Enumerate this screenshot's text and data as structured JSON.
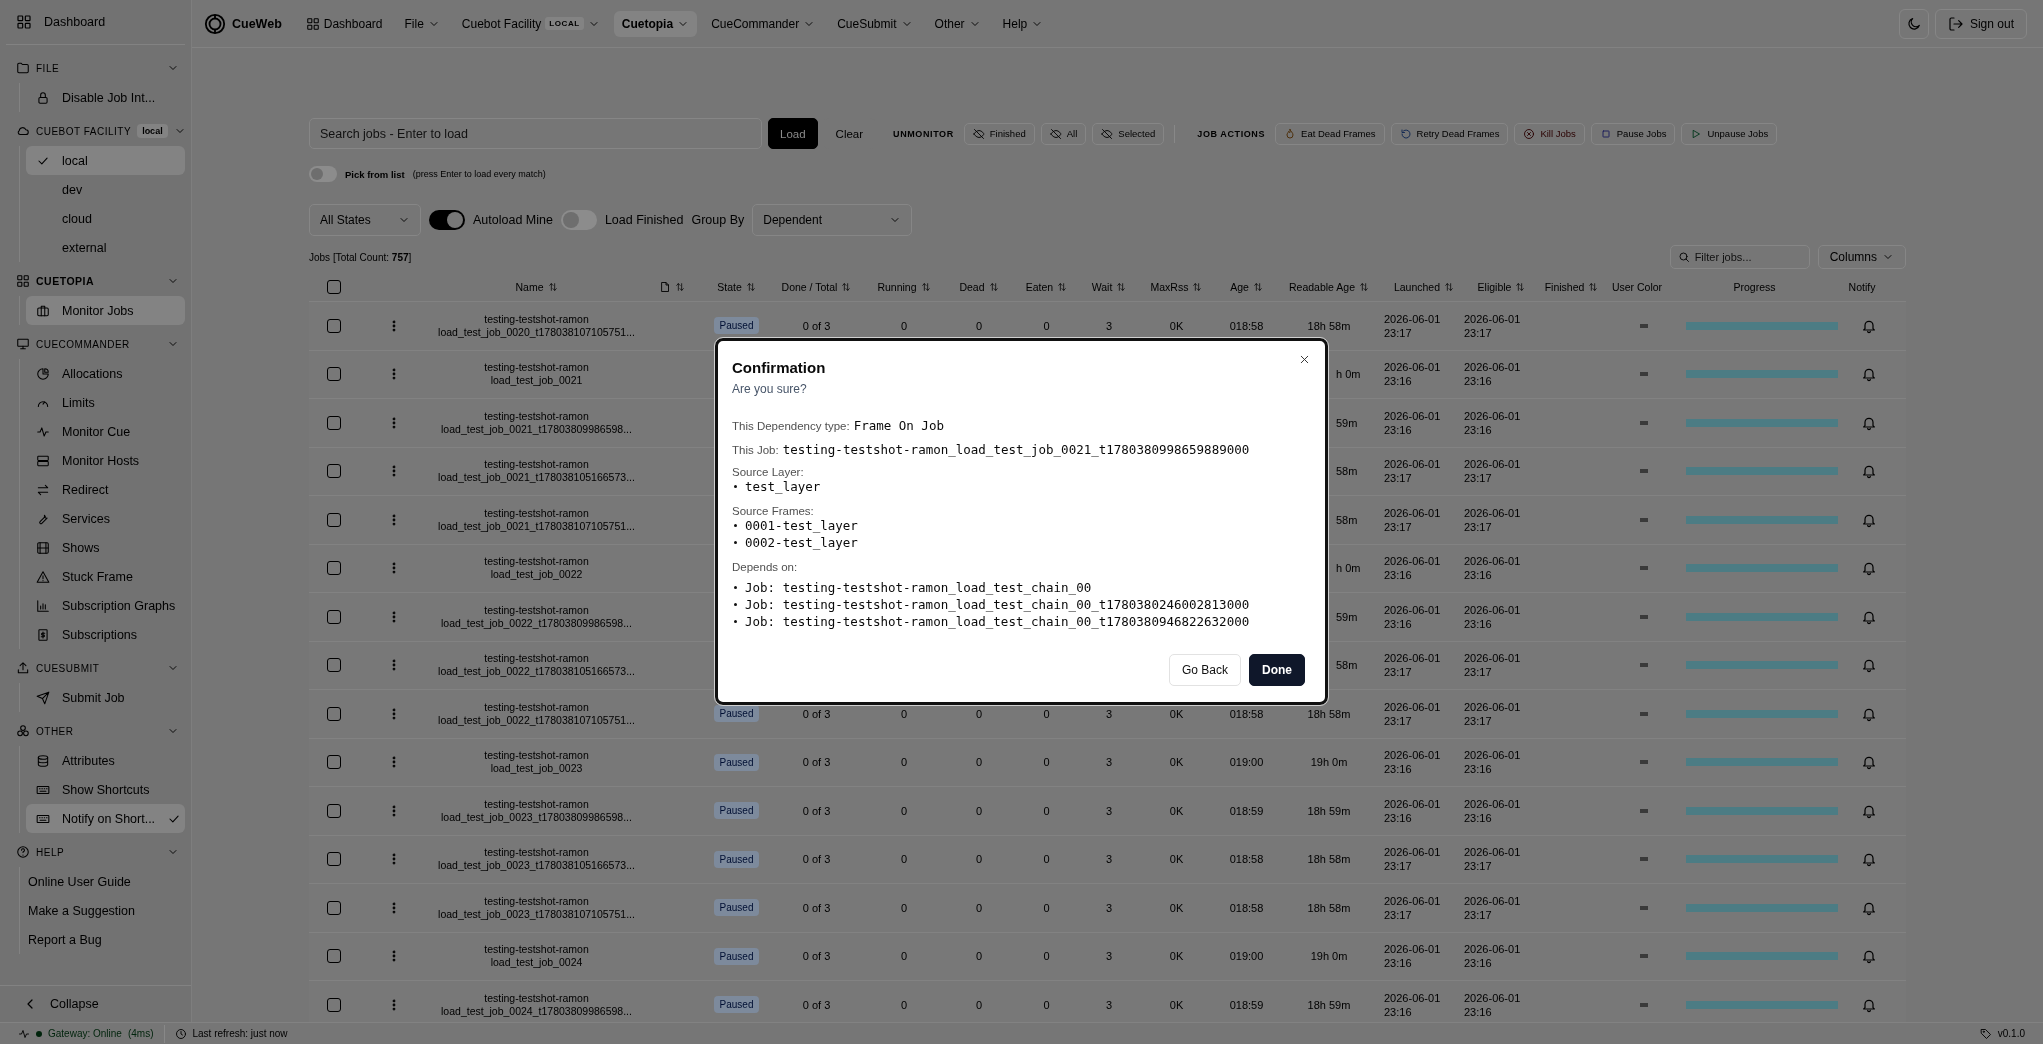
{
  "sidebar": {
    "dashboard": "Dashboard",
    "sections": [
      {
        "title": "FILE",
        "kind": "menu",
        "active": false,
        "items": [
          {
            "label": "Disable Job Int...",
            "selected": false
          }
        ]
      },
      {
        "title": "CUEBOT FACILITY",
        "badge": "local",
        "kind": "radio",
        "active": false,
        "items": [
          {
            "label": "local",
            "checked": true,
            "selected": true
          },
          {
            "label": "dev",
            "checked": false,
            "selected": false
          },
          {
            "label": "cloud",
            "checked": false,
            "selected": false
          },
          {
            "label": "external",
            "checked": false,
            "selected": false
          }
        ]
      },
      {
        "title": "CUETOPIA",
        "kind": "menu",
        "active": true,
        "items": [
          {
            "label": "Monitor Jobs",
            "selected": true
          }
        ]
      },
      {
        "title": "CUECOMMANDER",
        "kind": "menu",
        "active": false,
        "items": [
          {
            "label": "Allocations",
            "selected": false
          },
          {
            "label": "Limits",
            "selected": false
          },
          {
            "label": "Monitor Cue",
            "selected": false
          },
          {
            "label": "Monitor Hosts",
            "selected": false
          },
          {
            "label": "Redirect",
            "selected": false
          },
          {
            "label": "Services",
            "selected": false
          },
          {
            "label": "Shows",
            "selected": false
          },
          {
            "label": "Stuck Frame",
            "selected": false
          },
          {
            "label": "Subscription Graphs",
            "selected": false
          },
          {
            "label": "Subscriptions",
            "selected": false
          }
        ]
      },
      {
        "title": "CUESUBMIT",
        "kind": "menu",
        "active": false,
        "items": [
          {
            "label": "Submit Job",
            "selected": false
          }
        ]
      },
      {
        "title": "OTHER",
        "kind": "menu",
        "active": false,
        "items": [
          {
            "label": "Attributes",
            "selected": false,
            "checked": false
          },
          {
            "label": "Show Shortcuts",
            "selected": false,
            "checked": false
          },
          {
            "label": "Notify on Short...",
            "selected": true,
            "checked": true
          }
        ]
      },
      {
        "title": "HELP",
        "kind": "links",
        "active": false,
        "items": [
          {
            "label": "Online User Guide",
            "selected": false
          },
          {
            "label": "Make a Suggestion",
            "selected": false
          },
          {
            "label": "Report a Bug",
            "selected": false
          }
        ]
      }
    ],
    "collapse": "Collapse"
  },
  "nav": {
    "logo": "CueWeb",
    "items": [
      {
        "label": "Dashboard",
        "kind": "link",
        "selected": false
      },
      {
        "label": "File",
        "kind": "menu",
        "selected": false
      },
      {
        "label": "Cuebot Facility",
        "badge": "LOCAL",
        "kind": "menu",
        "selected": false
      },
      {
        "label": "Cuetopia",
        "kind": "menu",
        "selected": true
      },
      {
        "label": "CueCommander",
        "kind": "menu",
        "selected": false
      },
      {
        "label": "CueSubmit",
        "kind": "menu",
        "selected": false
      },
      {
        "label": "Other",
        "kind": "menu",
        "selected": false
      },
      {
        "label": "Help",
        "kind": "menu",
        "selected": false
      }
    ],
    "sign_out": "Sign out"
  },
  "toolbar": {
    "search": {
      "placeholder": "Search jobs - Enter to load"
    },
    "load": "Load",
    "clear": "Clear",
    "unmonitor": {
      "label": "UNMONITOR",
      "buttons": [
        "Finished",
        "All",
        "Selected"
      ]
    },
    "job_actions": {
      "label": "JOB ACTIONS",
      "buttons": [
        {
          "label": "Eat Dead Frames",
          "kind": "eat"
        },
        {
          "label": "Retry Dead Frames",
          "kind": "retry"
        },
        {
          "label": "Kill Jobs",
          "kind": "kill"
        },
        {
          "label": "Pause Jobs",
          "kind": "pause"
        },
        {
          "label": "Unpause Jobs",
          "kind": "unpause"
        }
      ]
    },
    "pick_from_list": {
      "label": "Pick from list",
      "hint": "(press Enter to load every match)",
      "on": false
    },
    "state_filter": "All States",
    "autoload_mine": {
      "label": "Autoload Mine",
      "on": true
    },
    "load_finished": {
      "label": "Load Finished",
      "on": false
    },
    "group_by": {
      "label": "Group By",
      "value": "Dependent"
    },
    "count": "Jobs [Total Count: **757**]",
    "filter": {
      "placeholder": "Filter jobs..."
    },
    "columns": "Columns"
  },
  "table": {
    "all_checked": false,
    "columns": [
      {
        "label": "Name",
        "kind": "text",
        "sortable": true
      },
      {
        "kind": "file",
        "sortable": true
      },
      {
        "label": "State",
        "kind": "text",
        "sortable": true
      },
      {
        "label": "Done / Total",
        "kind": "text",
        "sortable": true
      },
      {
        "label": "Running",
        "kind": "text",
        "sortable": true
      },
      {
        "label": "Dead",
        "kind": "text",
        "sortable": true
      },
      {
        "label": "Eaten",
        "kind": "text",
        "sortable": true
      },
      {
        "label": "Wait",
        "kind": "text",
        "sortable": true
      },
      {
        "label": "MaxRss",
        "kind": "text",
        "sortable": true
      },
      {
        "label": "Age",
        "kind": "text",
        "sortable": true
      },
      {
        "label": "Readable Age",
        "kind": "text",
        "sortable": true
      },
      {
        "label": "Launched",
        "kind": "text",
        "sortable": true
      },
      {
        "label": "Eligible",
        "kind": "text",
        "sortable": true
      },
      {
        "label": "Finished",
        "kind": "text",
        "sortable": true
      },
      {
        "label": "User Color",
        "kind": "text",
        "sortable": false
      },
      {
        "label": "Progress",
        "kind": "text",
        "sortable": false
      },
      {
        "label": "Notify",
        "kind": "text",
        "sortable": false
      }
    ],
    "rows": [
      {
        "checked": false,
        "name": [
          "testing-testshot-ramon",
          "load_test_job_0020_t178038107105751..."
        ],
        "level": 0,
        "state": "Paused",
        "done_total": "0 of 3",
        "running": "0",
        "dead": "0",
        "eaten": "0",
        "wait": "3",
        "maxrss": "0K",
        "age": "018:58",
        "readable_age": "18h 58m",
        "launched": "2026-06-01 23:17",
        "eligible": "2026-06-01 23:17"
      },
      {
        "checked": false,
        "name": [
          "testing-testshot-ramon",
          "load_test_job_0021"
        ],
        "level": 0,
        "readable_age": "h 0m",
        "launched": "2026-06-01 23:16",
        "eligible": "2026-06-01 23:16"
      },
      {
        "checked": false,
        "name": [
          "testing-testshot-ramon",
          "load_test_job_0021_t17803809986598..."
        ],
        "level": 0,
        "readable_age": "59m",
        "launched": "2026-06-01 23:16",
        "eligible": "2026-06-01 23:16"
      },
      {
        "checked": false,
        "name": [
          "testing-testshot-ramon",
          "load_test_job_0021_t178038105166573..."
        ],
        "level": 0,
        "readable_age": "58m",
        "launched": "2026-06-01 23:17",
        "eligible": "2026-06-01 23:17"
      },
      {
        "checked": false,
        "name": [
          "testing-testshot-ramon",
          "load_test_job_0021_t178038107105751..."
        ],
        "level": 0,
        "readable_age": "58m",
        "launched": "2026-06-01 23:17",
        "eligible": "2026-06-01 23:17"
      },
      {
        "checked": false,
        "name": [
          "testing-testshot-ramon",
          "load_test_job_0022"
        ],
        "level": 0,
        "readable_age": "h 0m",
        "launched": "2026-06-01 23:16",
        "eligible": "2026-06-01 23:16"
      },
      {
        "checked": false,
        "name": [
          "testing-testshot-ramon",
          "load_test_job_0022_t17803809986598..."
        ],
        "level": 0,
        "readable_age": "59m",
        "launched": "2026-06-01 23:16",
        "eligible": "2026-06-01 23:16"
      },
      {
        "checked": false,
        "name": [
          "testing-testshot-ramon",
          "load_test_job_0022_t178038105166573..."
        ],
        "level": 0,
        "readable_age": "58m",
        "launched": "2026-06-01 23:17",
        "eligible": "2026-06-01 23:17"
      },
      {
        "checked": false,
        "name": [
          "testing-testshot-ramon",
          "load_test_job_0022_t178038107105751..."
        ],
        "level": 0,
        "state": "Paused",
        "done_total": "0 of 3",
        "running": "0",
        "dead": "0",
        "eaten": "0",
        "wait": "3",
        "maxrss": "0K",
        "age": "018:58",
        "readable_age": "18h 58m",
        "launched": "2026-06-01 23:17",
        "eligible": "2026-06-01 23:17"
      },
      {
        "checked": false,
        "name": [
          "testing-testshot-ramon",
          "load_test_job_0023"
        ],
        "level": 0,
        "state": "Paused",
        "done_total": "0 of 3",
        "running": "0",
        "dead": "0",
        "eaten": "0",
        "wait": "3",
        "maxrss": "0K",
        "age": "019:00",
        "readable_age": "19h 0m",
        "launched": "2026-06-01 23:16",
        "eligible": "2026-06-01 23:16"
      },
      {
        "checked": false,
        "name": [
          "testing-testshot-ramon",
          "load_test_job_0023_t17803809986598..."
        ],
        "level": 0,
        "state": "Paused",
        "done_total": "0 of 3",
        "running": "0",
        "dead": "0",
        "eaten": "0",
        "wait": "3",
        "maxrss": "0K",
        "age": "018:59",
        "readable_age": "18h 59m",
        "launched": "2026-06-01 23:16",
        "eligible": "2026-06-01 23:16"
      },
      {
        "checked": false,
        "name": [
          "testing-testshot-ramon",
          "load_test_job_0023_t178038105166573..."
        ],
        "level": 0,
        "state": "Paused",
        "done_total": "0 of 3",
        "running": "0",
        "dead": "0",
        "eaten": "0",
        "wait": "3",
        "maxrss": "0K",
        "age": "018:58",
        "readable_age": "18h 58m",
        "launched": "2026-06-01 23:17",
        "eligible": "2026-06-01 23:17"
      },
      {
        "checked": false,
        "name": [
          "testing-testshot-ramon",
          "load_test_job_0023_t178038107105751..."
        ],
        "level": 0,
        "state": "Paused",
        "done_total": "0 of 3",
        "running": "0",
        "dead": "0",
        "eaten": "0",
        "wait": "3",
        "maxrss": "0K",
        "age": "018:58",
        "readable_age": "18h 58m",
        "launched": "2026-06-01 23:17",
        "eligible": "2026-06-01 23:17"
      },
      {
        "checked": false,
        "name": [
          "testing-testshot-ramon",
          "load_test_job_0024"
        ],
        "level": 0,
        "state": "Paused",
        "done_total": "0 of 3",
        "running": "0",
        "dead": "0",
        "eaten": "0",
        "wait": "3",
        "maxrss": "0K",
        "age": "019:00",
        "readable_age": "19h 0m",
        "launched": "2026-06-01 23:16",
        "eligible": "2026-06-01 23:16"
      },
      {
        "checked": false,
        "name": [
          "testing-testshot-ramon",
          "load_test_job_0024_t17803809986598..."
        ],
        "level": 0,
        "state": "Paused",
        "done_total": "0 of 3",
        "running": "0",
        "dead": "0",
        "eaten": "0",
        "wait": "3",
        "maxrss": "0K",
        "age": "018:59",
        "readable_age": "18h 59m",
        "launched": "2026-06-01 23:16",
        "eligible": "2026-06-01 23:16"
      }
    ]
  },
  "dialog": {
    "title": "Confirmation",
    "subtitle": "Are you sure?",
    "fields": [
      {
        "label": "This Dependency type:",
        "value": "Frame On Job"
      },
      {
        "label": "This Job:",
        "value": "testing-testshot-ramon_load_test_job_0021_t1780380998659889000"
      }
    ],
    "lists": [
      {
        "label": "Source Layer:",
        "items": [
          "test_layer"
        ]
      },
      {
        "label": "Source Frames:",
        "items": [
          "0001-test_layer",
          "0002-test_layer"
        ]
      },
      {
        "label": "Depends on:",
        "items": [
          "Job: testing-testshot-ramon_load_test_chain_00",
          "Job: testing-testshot-ramon_load_test_chain_00_t1780380246002813000",
          "Job: testing-testshot-ramon_load_test_chain_00_t1780380946822632000"
        ]
      }
    ],
    "buttons": [
      {
        "label": "Go Back",
        "kind": "secondary"
      },
      {
        "label": "Done",
        "kind": "primary"
      }
    ]
  },
  "status_bar": {
    "gateway": "Gateway: Online",
    "latency": "(4ms)",
    "refresh": "Last refresh: just now",
    "version": "v0.1.0"
  }
}
